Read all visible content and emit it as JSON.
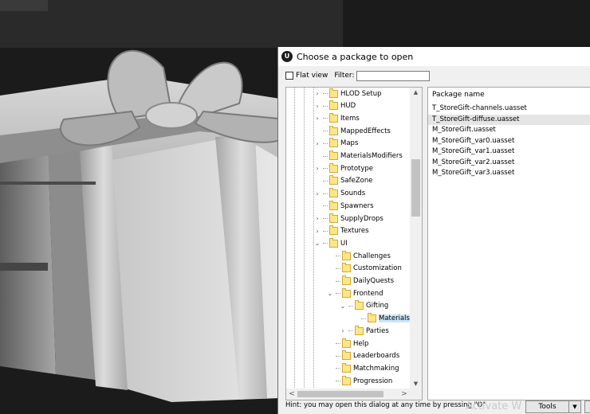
{
  "dialog": {
    "title": "Choose a package to open",
    "app_icon": "unreal-logo-icon",
    "flat_view_label": "Flat view",
    "flat_view_checked": false,
    "filter_label": "Filter:",
    "filter_value": ""
  },
  "tree": {
    "nodes": [
      {
        "label": "HLOD Setup",
        "expander": "collapsed",
        "depth": 0
      },
      {
        "label": "HUD",
        "expander": "collapsed",
        "depth": 0
      },
      {
        "label": "Items",
        "expander": "collapsed",
        "depth": 0
      },
      {
        "label": "MappedEffects",
        "expander": "none",
        "depth": 0
      },
      {
        "label": "Maps",
        "expander": "collapsed",
        "depth": 0
      },
      {
        "label": "MaterialsModifiers",
        "expander": "none",
        "depth": 0
      },
      {
        "label": "Prototype",
        "expander": "collapsed",
        "depth": 0
      },
      {
        "label": "SafeZone",
        "expander": "none",
        "depth": 0
      },
      {
        "label": "Sounds",
        "expander": "collapsed",
        "depth": 0
      },
      {
        "label": "Spawners",
        "expander": "none",
        "depth": 0
      },
      {
        "label": "SupplyDrops",
        "expander": "collapsed",
        "depth": 0
      },
      {
        "label": "Textures",
        "expander": "collapsed",
        "depth": 0
      },
      {
        "label": "UI",
        "expander": "expanded",
        "depth": 0
      },
      {
        "label": "Challenges",
        "expander": "none",
        "depth": 1
      },
      {
        "label": "Customization",
        "expander": "none",
        "depth": 1
      },
      {
        "label": "DailyQuests",
        "expander": "none",
        "depth": 1
      },
      {
        "label": "Frontend",
        "expander": "expanded",
        "depth": 1
      },
      {
        "label": "Gifting",
        "expander": "expanded",
        "depth": 2
      },
      {
        "label": "Materials",
        "expander": "none",
        "depth": 3,
        "selected": true
      },
      {
        "label": "Parties",
        "expander": "collapsed",
        "depth": 2
      },
      {
        "label": "Help",
        "expander": "none",
        "depth": 1
      },
      {
        "label": "Leaderboards",
        "expander": "none",
        "depth": 1
      },
      {
        "label": "Matchmaking",
        "expander": "none",
        "depth": 1
      },
      {
        "label": "Progression",
        "expander": "none",
        "depth": 1
      }
    ]
  },
  "packages": {
    "header": "Package name",
    "rows": [
      {
        "name": "T_StoreGift-channels.uasset",
        "selected": false
      },
      {
        "name": "T_StoreGift-diffuse.uasset",
        "selected": true
      },
      {
        "name": "M_StoreGift.uasset",
        "selected": false
      },
      {
        "name": "M_StoreGift_var0.uasset",
        "selected": false
      },
      {
        "name": "M_StoreGift_var1.uasset",
        "selected": false
      },
      {
        "name": "M_StoreGift_var2.uasset",
        "selected": false
      },
      {
        "name": "M_StoreGift_var3.uasset",
        "selected": false
      }
    ]
  },
  "footer": {
    "hint": "Hint: you may open this dialog at any time by pressing \"O\"",
    "tools_label": "Tools",
    "watermark": "Activate W"
  },
  "colors": {
    "folder_fill": "#fde68a",
    "selection": "#cde6f7",
    "list_selection": "#e5e5e5"
  }
}
